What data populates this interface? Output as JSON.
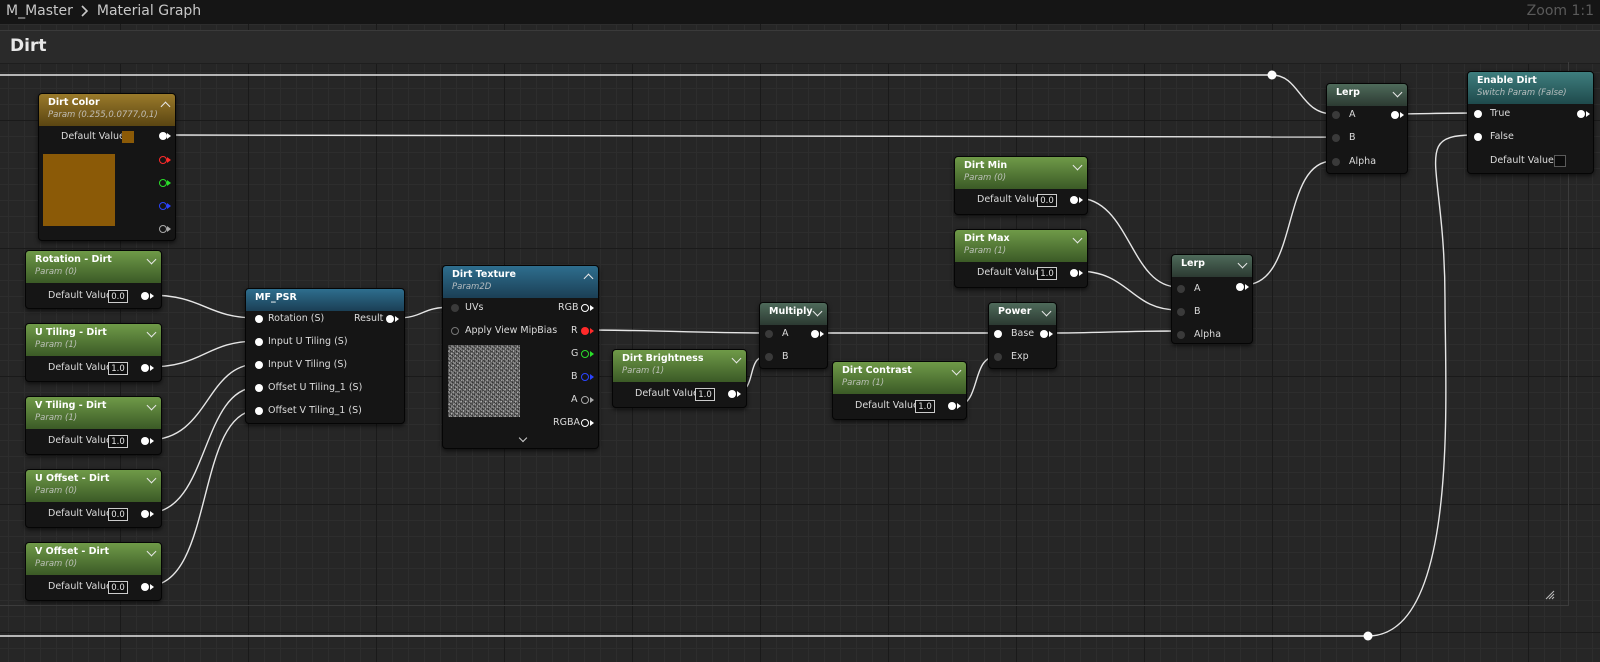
{
  "topbar": {
    "asset": "M_Master",
    "graph": "Material Graph",
    "zoom": "Zoom 1:1"
  },
  "comment": {
    "title": "Dirt"
  },
  "colors": {
    "dirt_color": "#8b5a07",
    "pin_r": "#ff2a2a",
    "pin_g": "#2adf2a",
    "pin_b": "#2a44ff",
    "wire": "#e6e6e6"
  },
  "icons": {
    "breadcrumb": "chevron-right-icon",
    "collapse": "chevron-down-icon",
    "expand": "chevron-up-icon"
  },
  "nodes": {
    "dirt_color": {
      "title": "Dirt Color",
      "subtitle": "Param (0.255,0.0777,0,1)",
      "default_label": "Default Value"
    },
    "rotation": {
      "title": "Rotation - Dirt",
      "subtitle": "Param (0)",
      "default_label": "Default Value",
      "value": "0.0"
    },
    "u_tiling": {
      "title": "U Tiling - Dirt",
      "subtitle": "Param (1)",
      "default_label": "Default Value",
      "value": "1.0"
    },
    "v_tiling": {
      "title": "V Tiling - Dirt",
      "subtitle": "Param (1)",
      "default_label": "Default Value",
      "value": "1.0"
    },
    "u_offset": {
      "title": "U Offset - Dirt",
      "subtitle": "Param (0)",
      "default_label": "Default Value",
      "value": "0.0"
    },
    "v_offset": {
      "title": "V Offset - Dirt",
      "subtitle": "Param (0)",
      "default_label": "Default Value",
      "value": "0.0"
    },
    "mf_psr": {
      "title": "MF_PSR",
      "inputs": [
        "Rotation (S)",
        "Input U Tiling (S)",
        "Input V Tiling (S)",
        "Offset U Tiling_1 (S)",
        "Offset V Tiling_1 (S)"
      ],
      "output": "Result"
    },
    "dirt_texture": {
      "title": "Dirt Texture",
      "subtitle": "Param2D",
      "inputs": [
        "UVs",
        "Apply View MipBias"
      ],
      "outputs": [
        "RGB",
        "R",
        "G",
        "B",
        "A",
        "RGBA"
      ]
    },
    "multiply": {
      "title": "Multiply",
      "inputs": [
        "A",
        "B"
      ]
    },
    "dirt_brightness": {
      "title": "Dirt Brightness",
      "subtitle": "Param (1)",
      "default_label": "Default Value",
      "value": "1.0"
    },
    "power": {
      "title": "Power",
      "inputs": [
        "Base",
        "Exp"
      ]
    },
    "dirt_contrast": {
      "title": "Dirt Contrast",
      "subtitle": "Param (1)",
      "default_label": "Default Value",
      "value": "1.0"
    },
    "dirt_min": {
      "title": "Dirt Min",
      "subtitle": "Param (0)",
      "default_label": "Default Value",
      "value": "0.0"
    },
    "dirt_max": {
      "title": "Dirt Max",
      "subtitle": "Param (1)",
      "default_label": "Default Value",
      "value": "1.0"
    },
    "lerp_inner": {
      "title": "Lerp",
      "inputs": [
        "A",
        "B",
        "Alpha"
      ]
    },
    "lerp_outer": {
      "title": "Lerp",
      "inputs": [
        "A",
        "B",
        "Alpha"
      ]
    },
    "enable_dirt": {
      "title": "Enable Dirt",
      "subtitle": "Switch Param (False)",
      "inputs": [
        "True",
        "False"
      ],
      "default_label": "Default Value"
    }
  }
}
